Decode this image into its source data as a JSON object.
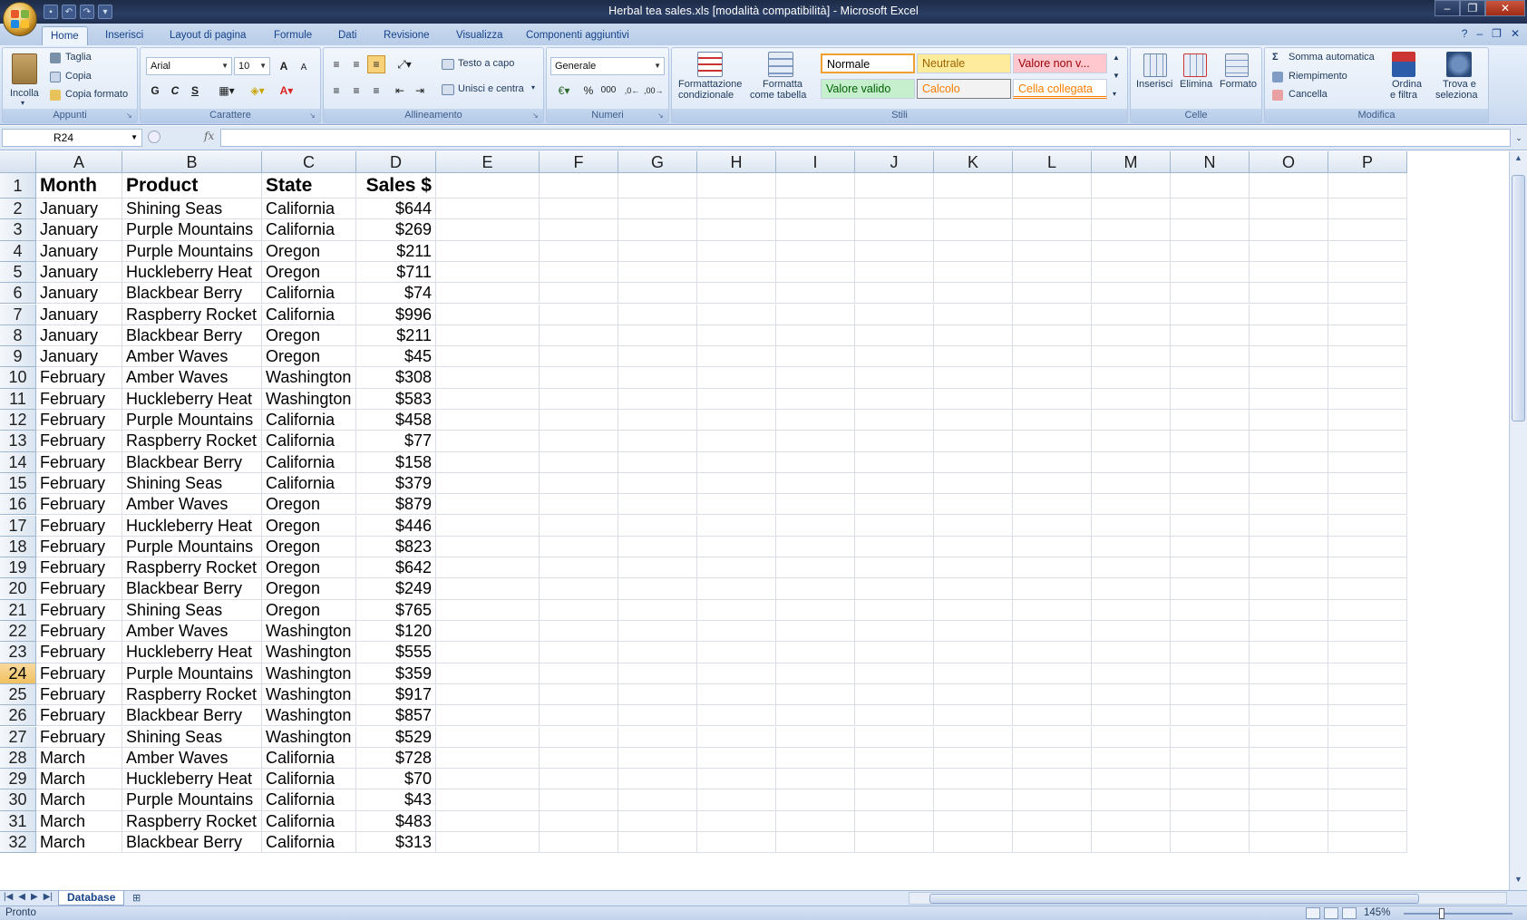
{
  "window": {
    "title": "Herbal tea sales.xls  [modalità compatibilità] - Microsoft Excel",
    "controls": [
      "–",
      "❐",
      "✕"
    ]
  },
  "quick_access": [
    "save-icon",
    "undo-icon",
    "redo-icon",
    "customize-icon"
  ],
  "tabs": [
    "Home",
    "Inserisci",
    "Layout di pagina",
    "Formule",
    "Dati",
    "Revisione",
    "Visualizza",
    "Componenti aggiuntivi"
  ],
  "active_tab": "Home",
  "ribbon": {
    "clipboard": {
      "label": "Appunti",
      "paste": "Incolla",
      "cut": "Taglia",
      "copy": "Copia",
      "format_painter": "Copia formato"
    },
    "font": {
      "label": "Carattere",
      "font_name": "Arial",
      "font_size": "10",
      "bold": "G",
      "italic": "C",
      "underline": "S"
    },
    "alignment": {
      "label": "Allineamento",
      "wrap": "Testo a capo",
      "merge": "Unisci e centra"
    },
    "number": {
      "label": "Numeri",
      "format": "Generale"
    },
    "styles": {
      "label": "Stili",
      "conditional": [
        "Formattazione",
        "condizionale"
      ],
      "as_table": [
        "Formatta",
        "come tabella"
      ],
      "cells": [
        {
          "name": "Normale",
          "bg": "#ffffff",
          "fg": "#000000"
        },
        {
          "name": "Neutrale",
          "bg": "#ffeb9c",
          "fg": "#9c6500"
        },
        {
          "name": "Valore non v...",
          "bg": "#ffc7ce",
          "fg": "#9c0006"
        },
        {
          "name": "Valore valido",
          "bg": "#c6efce",
          "fg": "#006100"
        },
        {
          "name": "Calcolo",
          "bg": "#f2f2f2",
          "fg": "#fa7d00"
        },
        {
          "name": "Cella collegata",
          "bg": "#ffffff",
          "fg": "#fa7d00"
        }
      ]
    },
    "cells": {
      "label": "Celle",
      "insert": "Inserisci",
      "delete": "Elimina",
      "format": "Formato"
    },
    "editing": {
      "label": "Modifica",
      "autosum": "Somma automatica",
      "fill": "Riempimento",
      "clear": "Cancella",
      "sort": [
        "Ordina",
        "e filtra"
      ],
      "find": [
        "Trova e",
        "seleziona"
      ]
    }
  },
  "formula_bar": {
    "name_box": "R24",
    "fx": "fx",
    "formula": ""
  },
  "sheet": {
    "columns": [
      "A",
      "B",
      "C",
      "D",
      "E",
      "F",
      "G",
      "H",
      "I",
      "J",
      "K",
      "L",
      "M",
      "N",
      "O",
      "P"
    ],
    "selected_row": 24,
    "header_row": [
      "Month",
      "Product",
      "State",
      "Sales $"
    ],
    "rows": [
      [
        "January",
        "Shining Seas",
        "California",
        "$644"
      ],
      [
        "January",
        "Purple Mountains",
        "California",
        "$269"
      ],
      [
        "January",
        "Purple Mountains",
        "Oregon",
        "$211"
      ],
      [
        "January",
        "Huckleberry Heat",
        "Oregon",
        "$711"
      ],
      [
        "January",
        "Blackbear Berry",
        "California",
        "$74"
      ],
      [
        "January",
        "Raspberry Rocket",
        "California",
        "$996"
      ],
      [
        "January",
        "Blackbear Berry",
        "Oregon",
        "$211"
      ],
      [
        "January",
        "Amber Waves",
        "Oregon",
        "$45"
      ],
      [
        "February",
        "Amber Waves",
        "Washington",
        "$308"
      ],
      [
        "February",
        "Huckleberry Heat",
        "Washington",
        "$583"
      ],
      [
        "February",
        "Purple Mountains",
        "California",
        "$458"
      ],
      [
        "February",
        "Raspberry Rocket",
        "California",
        "$77"
      ],
      [
        "February",
        "Blackbear Berry",
        "California",
        "$158"
      ],
      [
        "February",
        "Shining Seas",
        "California",
        "$379"
      ],
      [
        "February",
        "Amber Waves",
        "Oregon",
        "$879"
      ],
      [
        "February",
        "Huckleberry Heat",
        "Oregon",
        "$446"
      ],
      [
        "February",
        "Purple Mountains",
        "Oregon",
        "$823"
      ],
      [
        "February",
        "Raspberry Rocket",
        "Oregon",
        "$642"
      ],
      [
        "February",
        "Blackbear Berry",
        "Oregon",
        "$249"
      ],
      [
        "February",
        "Shining Seas",
        "Oregon",
        "$765"
      ],
      [
        "February",
        "Amber Waves",
        "Washington",
        "$120"
      ],
      [
        "February",
        "Huckleberry Heat",
        "Washington",
        "$555"
      ],
      [
        "February",
        "Purple Mountains",
        "Washington",
        "$359"
      ],
      [
        "February",
        "Raspberry Rocket",
        "Washington",
        "$917"
      ],
      [
        "February",
        "Blackbear Berry",
        "Washington",
        "$857"
      ],
      [
        "February",
        "Shining Seas",
        "Washington",
        "$529"
      ],
      [
        "March",
        "Amber Waves",
        "California",
        "$728"
      ],
      [
        "March",
        "Huckleberry Heat",
        "California",
        "$70"
      ],
      [
        "March",
        "Purple Mountains",
        "California",
        "$43"
      ],
      [
        "March",
        "Raspberry Rocket",
        "California",
        "$483"
      ],
      [
        "March",
        "Blackbear Berry",
        "California",
        "$313"
      ]
    ]
  },
  "sheet_tabs": [
    "Database"
  ],
  "status": {
    "text": "Pronto",
    "zoom": "145%",
    "zoom_level_pct": 145
  }
}
